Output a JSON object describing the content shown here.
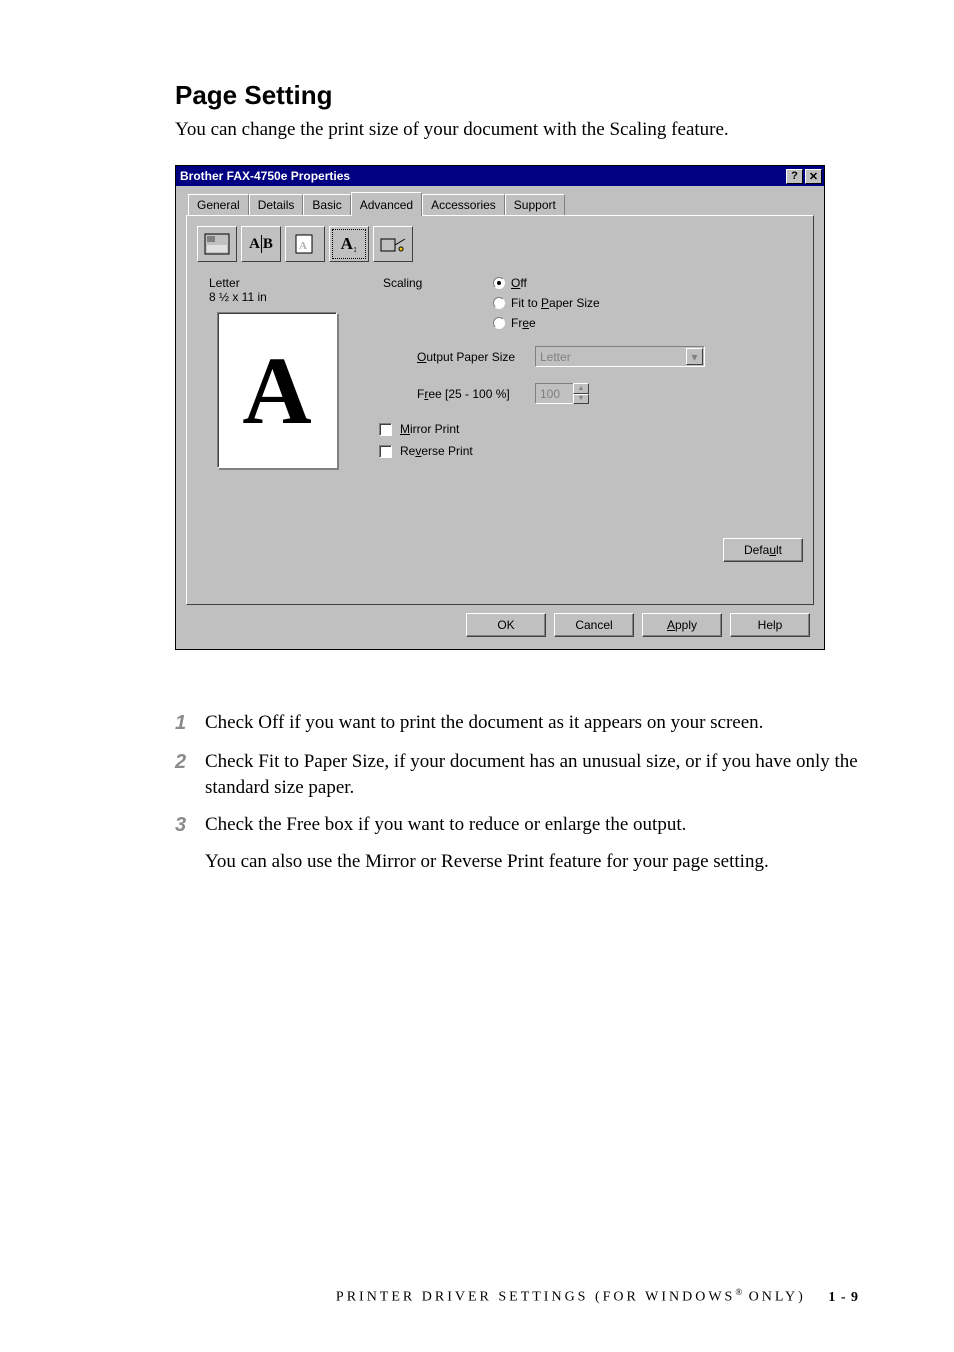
{
  "heading": "Page Setting",
  "intro": "You can change the print size of your document with the Scaling feature.",
  "dialog": {
    "title": "Brother FAX-4750e Properties",
    "help_glyph": "?",
    "close_glyph": "✕",
    "tabs": {
      "general": "General",
      "details": "Details",
      "basic": "Basic",
      "advanced": "Advanced",
      "accessories": "Accessories",
      "support": "Support"
    },
    "toolbar_icons": {
      "halftone": "halftone",
      "ab_side": "AB",
      "watermark": "watermark",
      "page_setting": "A",
      "device_options": "device"
    },
    "paper": {
      "name": "Letter",
      "dimensions": "8 ½ x 11 in",
      "preview_glyph": "A"
    },
    "scaling": {
      "label": "Scaling",
      "off": "Off",
      "fit": "Fit to Paper Size",
      "free": "Free"
    },
    "output_paper_size": {
      "label": "Output Paper Size",
      "value": "Letter"
    },
    "free_range": {
      "label": "Free [25 - 100 %]",
      "value": "100"
    },
    "mirror": "Mirror Print",
    "reverse": "Reverse Print",
    "default_btn": "Default",
    "buttons": {
      "ok": "OK",
      "cancel": "Cancel",
      "apply": "Apply",
      "help": "Help"
    }
  },
  "instructions": {
    "i1": "Check Off if you want to print the document as it appears on your screen.",
    "i2": "Check Fit to Paper Size, if your document has an unusual size, or if you have only the standard size paper.",
    "i3": "Check the Free box if you want to reduce or enlarge the output.",
    "i3b": "You can also use the Mirror or Reverse Print feature for your page setting."
  },
  "footer": {
    "text_before": "PRINTER DRIVER SETTINGS (FOR WINDOWS",
    "reg": "®",
    "text_after": " ONLY)",
    "page": "1 - 9"
  }
}
